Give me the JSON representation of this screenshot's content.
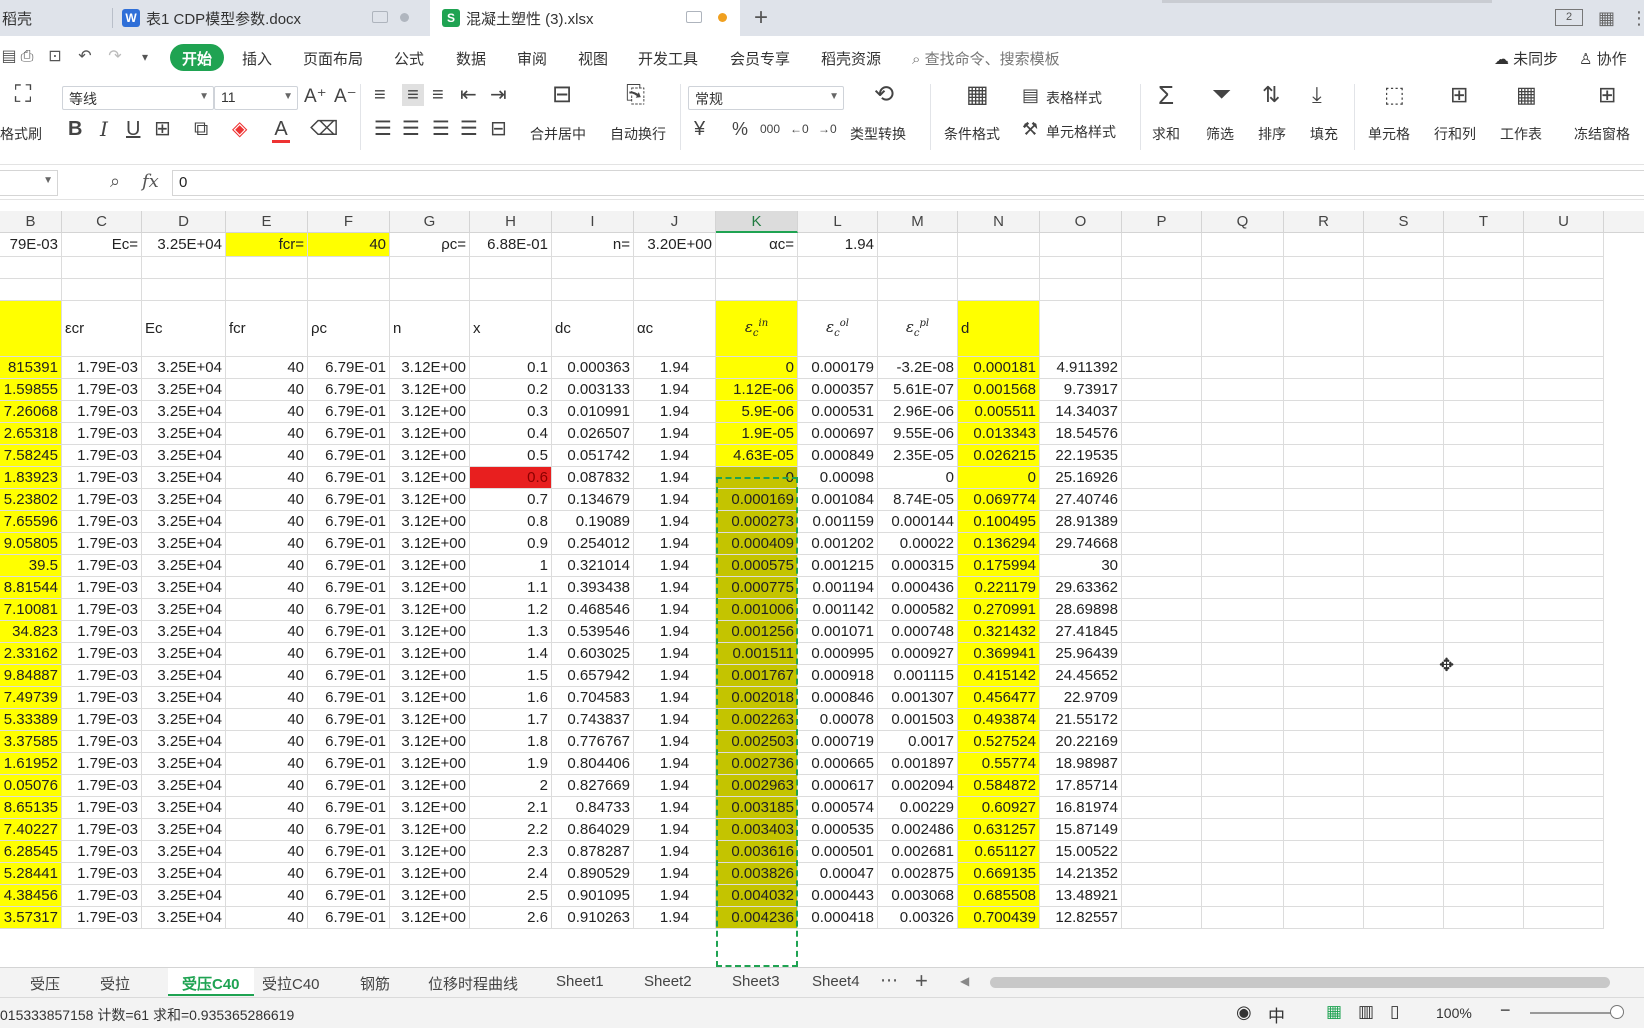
{
  "tabs": [
    {
      "label": "稻壳",
      "icon": ""
    },
    {
      "label": "表1 CDP模型参数.docx",
      "icon": "W"
    },
    {
      "label": "混凝土塑性 (3).xlsx",
      "icon": "S"
    }
  ],
  "menu": {
    "items": [
      "开始",
      "插入",
      "页面布局",
      "公式",
      "数据",
      "审阅",
      "视图",
      "开发工具",
      "会员专享",
      "稻壳资源"
    ],
    "active": "开始",
    "search_placeholder": "查找命令、搜索模板",
    "sync": "未同步",
    "collab": "协作"
  },
  "ribbon": {
    "format_painter": "格式刷",
    "font_name": "等线",
    "font_size": "11",
    "number_format": "常规",
    "merge_center": "合并居中",
    "wrap_text": "自动换行",
    "type_convert": "类型转换",
    "cond_format": "条件格式",
    "table_style": "表格样式",
    "cell_style": "单元格样式",
    "sum": "求和",
    "filter": "筛选",
    "sort": "排序",
    "fill": "填充",
    "cell": "单元格",
    "rowcol": "行和列",
    "worksheet": "工作表",
    "freeze": "冻结窗格",
    "bold": "B",
    "italic": "I",
    "underline": "U",
    "currency": "¥",
    "percent": "%",
    "thousands": "000"
  },
  "formula": {
    "fx": "fx",
    "value": "0"
  },
  "columns": [
    "B",
    "C",
    "D",
    "E",
    "F",
    "G",
    "H",
    "I",
    "J",
    "K",
    "L",
    "M",
    "N",
    "O",
    "P",
    "Q",
    "R",
    "S",
    "T",
    "U"
  ],
  "selected_column": "K",
  "row1": [
    "79E-03",
    "Ec=",
    "3.25E+04",
    "fcr=",
    "40",
    "ρc=",
    "6.88E-01",
    "n=",
    "3.20E+00",
    "αc=",
    "1.94"
  ],
  "headers": [
    "",
    "εcr",
    "Ec",
    "fcr",
    "ρc",
    "n",
    "x",
    "dc",
    "αc",
    "",
    "",
    "",
    "d"
  ],
  "math_headers": {
    "K": {
      "base": "ε",
      "sup": "in",
      "sub": "c"
    },
    "L": {
      "base": "ε",
      "sup": "ol",
      "sub": "c"
    },
    "M": {
      "base": "ε",
      "sup": "pl",
      "sub": "c"
    }
  },
  "common": {
    "C": "1.79E-03",
    "D": "3.25E+04",
    "E": "40",
    "F": "6.79E-01",
    "G": "3.12E+00",
    "J": "1.94"
  },
  "rows": [
    [
      "815391",
      "0.1",
      "0.000363",
      "0",
      "0.000179",
      "-3.2E-08",
      "0.000181",
      "4.911392"
    ],
    [
      "1.59855",
      "0.2",
      "0.003133",
      "1.12E-06",
      "0.000357",
      "5.61E-07",
      "0.001568",
      "9.73917"
    ],
    [
      "7.26068",
      "0.3",
      "0.010991",
      "5.9E-06",
      "0.000531",
      "2.96E-06",
      "0.005511",
      "14.34037"
    ],
    [
      "2.65318",
      "0.4",
      "0.026507",
      "1.9E-05",
      "0.000697",
      "9.55E-06",
      "0.013343",
      "18.54576"
    ],
    [
      "7.58245",
      "0.5",
      "0.051742",
      "4.63E-05",
      "0.000849",
      "2.35E-05",
      "0.026215",
      "22.19535"
    ],
    [
      "1.83923",
      "0.6",
      "0.087832",
      "0",
      "0.00098",
      "0",
      "0",
      "25.16926"
    ],
    [
      "5.23802",
      "0.7",
      "0.134679",
      "0.000169",
      "0.001084",
      "8.74E-05",
      "0.069774",
      "27.40746"
    ],
    [
      "7.65596",
      "0.8",
      "0.19089",
      "0.000273",
      "0.001159",
      "0.000144",
      "0.100495",
      "28.91389"
    ],
    [
      "9.05805",
      "0.9",
      "0.254012",
      "0.000409",
      "0.001202",
      "0.00022",
      "0.136294",
      "29.74668"
    ],
    [
      "39.5",
      "1",
      "0.321014",
      "0.000575",
      "0.001215",
      "0.000315",
      "0.175994",
      "30"
    ],
    [
      "8.81544",
      "1.1",
      "0.393438",
      "0.000775",
      "0.001194",
      "0.000436",
      "0.221179",
      "29.63362"
    ],
    [
      "7.10081",
      "1.2",
      "0.468546",
      "0.001006",
      "0.001142",
      "0.000582",
      "0.270991",
      "28.69898"
    ],
    [
      "34.823",
      "1.3",
      "0.539546",
      "0.001256",
      "0.001071",
      "0.000748",
      "0.321432",
      "27.41845"
    ],
    [
      "2.33162",
      "1.4",
      "0.603025",
      "0.001511",
      "0.000995",
      "0.000927",
      "0.369941",
      "25.96439"
    ],
    [
      "9.84887",
      "1.5",
      "0.657942",
      "0.001767",
      "0.000918",
      "0.001115",
      "0.415142",
      "24.45652"
    ],
    [
      "7.49739",
      "1.6",
      "0.704583",
      "0.002018",
      "0.000846",
      "0.001307",
      "0.456477",
      "22.9709"
    ],
    [
      "5.33389",
      "1.7",
      "0.743837",
      "0.002263",
      "0.00078",
      "0.001503",
      "0.493874",
      "21.55172"
    ],
    [
      "3.37585",
      "1.8",
      "0.776767",
      "0.002503",
      "0.000719",
      "0.0017",
      "0.527524",
      "20.22169"
    ],
    [
      "1.61952",
      "1.9",
      "0.804406",
      "0.002736",
      "0.000665",
      "0.001897",
      "0.55774",
      "18.98987"
    ],
    [
      "0.05076",
      "2",
      "0.827669",
      "0.002963",
      "0.000617",
      "0.002094",
      "0.584872",
      "17.85714"
    ],
    [
      "8.65135",
      "2.1",
      "0.84733",
      "0.003185",
      "0.000574",
      "0.00229",
      "0.60927",
      "16.81974"
    ],
    [
      "7.40227",
      "2.2",
      "0.864029",
      "0.003403",
      "0.000535",
      "0.002486",
      "0.631257",
      "15.87149"
    ],
    [
      "6.28545",
      "2.3",
      "0.878287",
      "0.003616",
      "0.000501",
      "0.002681",
      "0.651127",
      "15.00522"
    ],
    [
      "5.28441",
      "2.4",
      "0.890529",
      "0.003826",
      "0.00047",
      "0.002875",
      "0.669135",
      "14.21352"
    ],
    [
      "4.38456",
      "2.5",
      "0.901095",
      "0.004032",
      "0.000443",
      "0.003068",
      "0.685508",
      "13.48921"
    ],
    [
      "3.57317",
      "2.6",
      "0.910263",
      "0.004236",
      "0.000418",
      "0.00326",
      "0.700439",
      "12.82557"
    ]
  ],
  "sheets": [
    "受压",
    "受拉",
    "受压C40",
    "受拉C40",
    "钢筋",
    "位移时程曲线",
    "Sheet1",
    "Sheet2",
    "Sheet3",
    "Sheet4"
  ],
  "active_sheet": "受压C40",
  "status": {
    "summary": "015333857158  计数=61  求和=0.935365286619",
    "zoom": "100%"
  },
  "colors": {
    "accent": "#1fa352",
    "highlight": "#ffff00",
    "error": "#e81f1f",
    "selection": "#c4c400"
  }
}
